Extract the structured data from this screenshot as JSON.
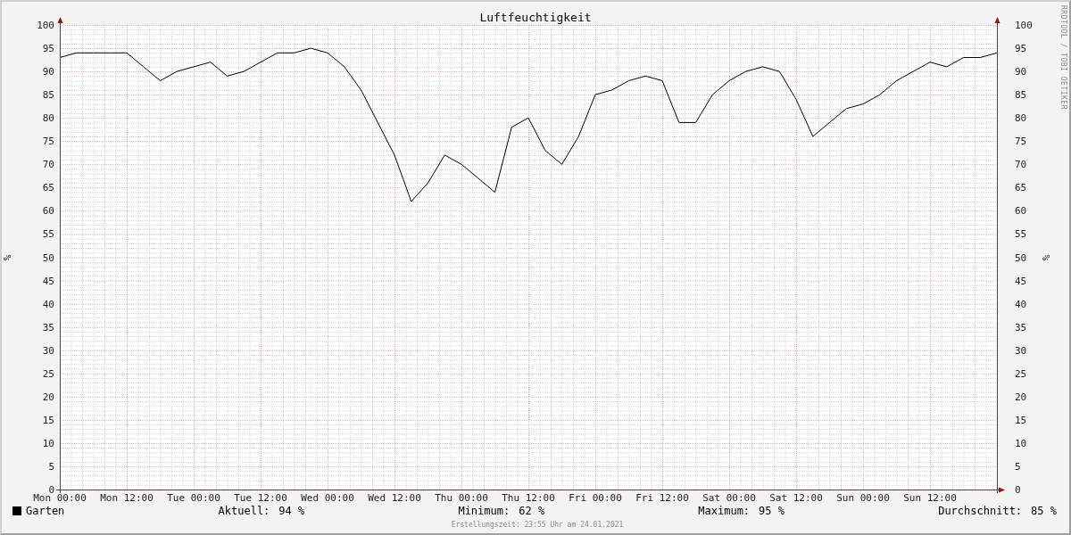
{
  "chart": {
    "chart_data": {
      "type": "line",
      "title": "Luftfeuchtigkeit",
      "ylabel": "%",
      "categories": [
        "Mon 00:00",
        null,
        null,
        null,
        "Mon 12:00",
        null,
        null,
        null,
        "Tue 00:00",
        null,
        null,
        null,
        "Tue 12:00",
        null,
        null,
        null,
        "Wed 00:00",
        null,
        null,
        null,
        "Wed 12:00",
        null,
        null,
        null,
        "Thu 00:00",
        null,
        null,
        null,
        "Thu 12:00",
        null,
        null,
        null,
        "Fri 00:00",
        null,
        null,
        null,
        "Fri 12:00",
        null,
        null,
        null,
        "Sat 00:00",
        null,
        null,
        null,
        "Sat 12:00",
        null,
        null,
        null,
        "Sun 00:00",
        null,
        null,
        null,
        "Sun 12:00",
        null,
        null,
        null,
        null
      ],
      "series": [
        {
          "name": "Garten",
          "color": "#000000",
          "values": [
            93,
            94,
            94,
            94,
            94,
            91,
            88,
            90,
            91,
            92,
            89,
            90,
            92,
            94,
            94,
            95,
            94,
            91,
            86,
            79,
            72,
            62,
            66,
            72,
            70,
            67,
            64,
            78,
            80,
            73,
            70,
            76,
            85,
            86,
            88,
            89,
            88,
            79,
            79,
            85,
            88,
            90,
            91,
            90,
            84,
            76,
            79,
            82,
            83,
            85,
            88,
            90,
            92,
            91,
            93,
            93,
            94
          ]
        }
      ],
      "ylim": [
        0,
        100
      ],
      "grid": true,
      "yticks": [
        100,
        95,
        90,
        85,
        80,
        75,
        70,
        65,
        60,
        55,
        50,
        45,
        40,
        35,
        30,
        25,
        20,
        15,
        10,
        5,
        0
      ]
    },
    "right_axis": {
      "label": "%",
      "ticks": [
        "100",
        "95",
        "90",
        "85",
        "80",
        "75",
        "70",
        "65",
        "60",
        "55",
        "50",
        "45",
        "40",
        "35",
        "30",
        "25",
        "20",
        "15",
        "10",
        "5",
        "0"
      ]
    }
  },
  "stats": [
    {
      "label": "Aktuell:",
      "value": "94 %"
    },
    {
      "label": "Minimum:",
      "value": "62 %"
    },
    {
      "label": "Maximum:",
      "value": "95 %"
    },
    {
      "label": "Durchschnitt:",
      "value": "85 %"
    }
  ],
  "footer": "Erstellungszeit: 23:55 Uhr am 24.01.2021",
  "credit": "RRDTOOL / TOBI OETIKER"
}
